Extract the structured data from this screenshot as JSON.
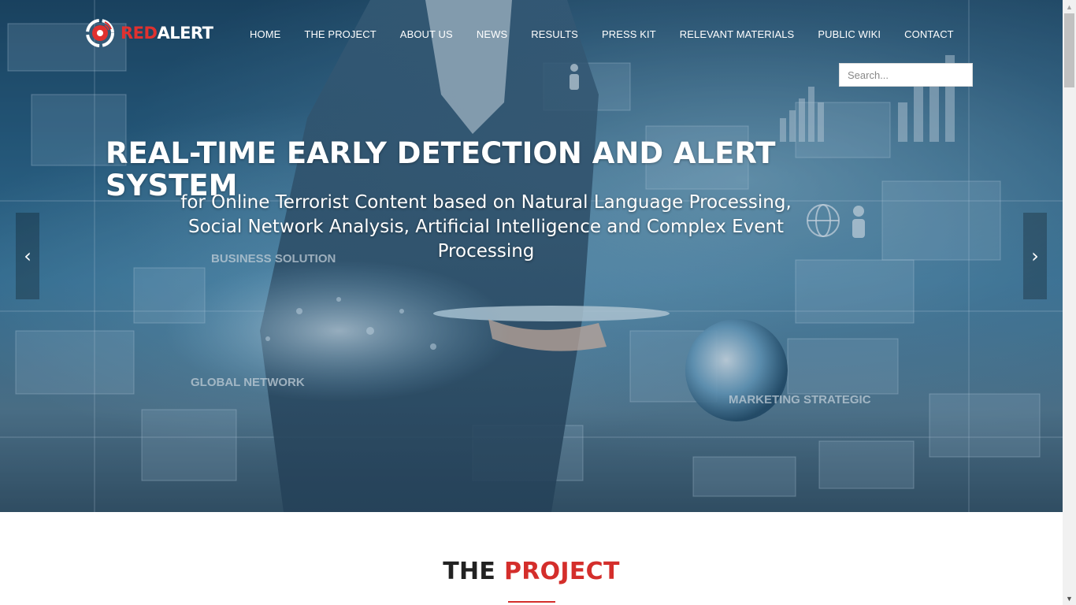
{
  "brand": {
    "part1": "RED",
    "part2": "ALERT",
    "accent_color": "#e0312f"
  },
  "nav": {
    "items": [
      {
        "label": "HOME"
      },
      {
        "label": "THE PROJECT"
      },
      {
        "label": "ABOUT US"
      },
      {
        "label": "NEWS"
      },
      {
        "label": "RESULTS"
      },
      {
        "label": "PRESS KIT"
      },
      {
        "label": "RELEVANT MATERIALS"
      },
      {
        "label": "PUBLIC WIKI"
      },
      {
        "label": "CONTACT"
      }
    ]
  },
  "search": {
    "placeholder": "Search...",
    "value": ""
  },
  "hero": {
    "title": "REAL-TIME EARLY DETECTION AND ALERT SYSTEM",
    "subtitle": "for Online Terrorist Content based on Natural Language Processing, Social Network Analysis, Artificial Intelligence and Complex Event Processing",
    "prev_icon": "chevron-left-icon",
    "next_icon": "chevron-right-icon",
    "image_words": [
      "BUSINESS SOLUTION",
      "GLOBAL NETWORK",
      "MARKETING STRATEGIC"
    ]
  },
  "section": {
    "title_part1": "THE",
    "title_part2": "PROJECT",
    "accent_color": "#d42e2b"
  }
}
